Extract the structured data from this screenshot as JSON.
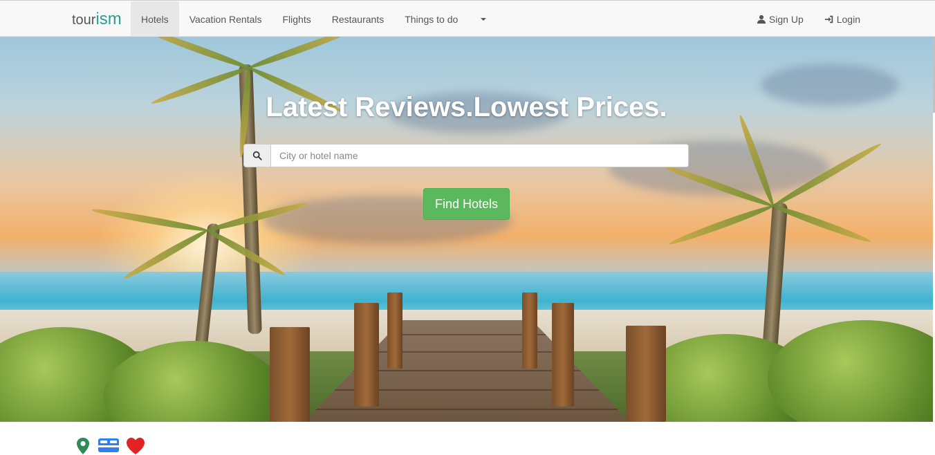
{
  "brand": {
    "prefix": "tour",
    "accent": "ism"
  },
  "nav": {
    "items": [
      {
        "label": "Hotels",
        "active": true
      },
      {
        "label": "Vacation Rentals"
      },
      {
        "label": "Flights"
      },
      {
        "label": "Restaurants"
      },
      {
        "label": "Things to do"
      }
    ],
    "dropdown_icon": "caret-down-icon",
    "signup_label": "Sign Up",
    "login_label": "Login"
  },
  "hero": {
    "title": "Latest Reviews.Lowest Prices.",
    "search_placeholder": "City or hotel name",
    "search_value": "",
    "find_button": "Find Hotels"
  },
  "features": {
    "icons": [
      "map-marker-icon",
      "bed-icon",
      "heart-icon"
    ]
  },
  "colors": {
    "accent": "#2a9d8f",
    "button": "#5cb85c",
    "marker": "#2e8b57",
    "bed": "#2f80ed",
    "heart": "#e02424"
  }
}
